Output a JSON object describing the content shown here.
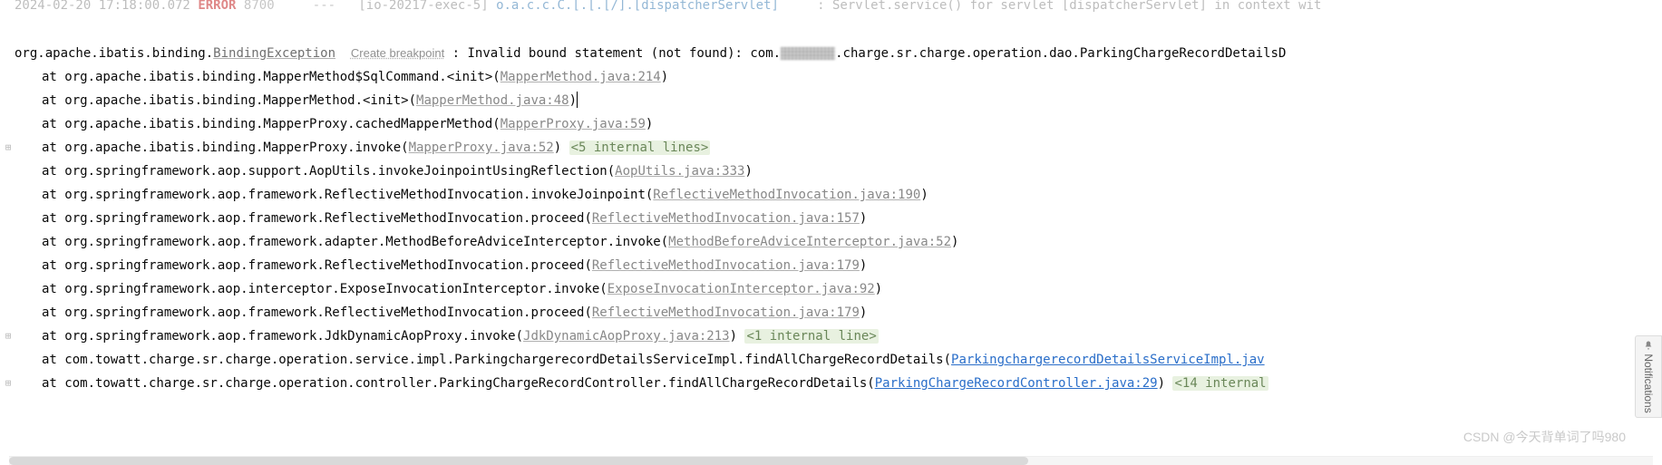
{
  "header": {
    "timestamp": "2024-02-20 17:18:00.072",
    "level": "ERROR",
    "code": "8700",
    "thread": "[io-20217-exec-5]",
    "logger": "o.a.c.c.C.[.[.[/].[dispatcherServlet]",
    "msg": ": Servlet.service() for servlet [dispatcherServlet] in context wit"
  },
  "exception": {
    "class_pkg": "org.apache.ibatis.binding.",
    "class_name": "BindingException",
    "create_bp": "Create breakpoint",
    "msg_head": " : Invalid bound statement (not found): com.",
    "msg_tail": ".charge.sr.charge.operation.dao.ParkingChargeRecordDetailsD"
  },
  "trace": [
    {
      "text": "at org.apache.ibatis.binding.MapperMethod$SqlCommand.<init>(",
      "link": "MapperMethod.java:214",
      "link_kind": "gray",
      "after": ")",
      "fold": null,
      "gutter": false
    },
    {
      "text": "at org.apache.ibatis.binding.MapperMethod.<init>(",
      "link": "MapperMethod.java:48",
      "link_kind": "gray",
      "after": ")",
      "fold": null,
      "caret": true,
      "gutter": false
    },
    {
      "text": "at org.apache.ibatis.binding.MapperProxy.cachedMapperMethod(",
      "link": "MapperProxy.java:59",
      "link_kind": "gray",
      "after": ")",
      "fold": null,
      "gutter": false
    },
    {
      "text": "at org.apache.ibatis.binding.MapperProxy.invoke(",
      "link": "MapperProxy.java:52",
      "link_kind": "gray",
      "after": ") ",
      "fold": "<5 internal lines>",
      "gutter": true
    },
    {
      "text": "at org.springframework.aop.support.AopUtils.invokeJoinpointUsingReflection(",
      "link": "AopUtils.java:333",
      "link_kind": "gray",
      "after": ")",
      "fold": null,
      "gutter": false
    },
    {
      "text": "at org.springframework.aop.framework.ReflectiveMethodInvocation.invokeJoinpoint(",
      "link": "ReflectiveMethodInvocation.java:190",
      "link_kind": "gray",
      "after": ")",
      "fold": null,
      "gutter": false
    },
    {
      "text": "at org.springframework.aop.framework.ReflectiveMethodInvocation.proceed(",
      "link": "ReflectiveMethodInvocation.java:157",
      "link_kind": "gray",
      "after": ")",
      "fold": null,
      "gutter": false
    },
    {
      "text": "at org.springframework.aop.framework.adapter.MethodBeforeAdviceInterceptor.invoke(",
      "link": "MethodBeforeAdviceInterceptor.java:52",
      "link_kind": "gray",
      "after": ")",
      "fold": null,
      "gutter": false
    },
    {
      "text": "at org.springframework.aop.framework.ReflectiveMethodInvocation.proceed(",
      "link": "ReflectiveMethodInvocation.java:179",
      "link_kind": "gray",
      "after": ")",
      "fold": null,
      "gutter": false
    },
    {
      "text": "at org.springframework.aop.interceptor.ExposeInvocationInterceptor.invoke(",
      "link": "ExposeInvocationInterceptor.java:92",
      "link_kind": "gray",
      "after": ")",
      "fold": null,
      "gutter": false
    },
    {
      "text": "at org.springframework.aop.framework.ReflectiveMethodInvocation.proceed(",
      "link": "ReflectiveMethodInvocation.java:179",
      "link_kind": "gray",
      "after": ")",
      "fold": null,
      "gutter": false
    },
    {
      "text": "at org.springframework.aop.framework.JdkDynamicAopProxy.invoke(",
      "link": "JdkDynamicAopProxy.java:213",
      "link_kind": "gray",
      "after": ") ",
      "fold": "<1 internal line>",
      "gutter": true
    },
    {
      "text": "at com.towatt.charge.sr.charge.operation.service.impl.ParkingchargerecordDetailsServiceImpl.findAllChargeRecordDetails(",
      "link": "ParkingchargerecordDetailsServiceImpl.jav",
      "link_kind": "blue",
      "after": "",
      "fold": null,
      "gutter": false
    },
    {
      "text": "at com.towatt.charge.sr.charge.operation.controller.ParkingChargeRecordController.findAllChargeRecordDetails(",
      "link": "ParkingChargeRecordController.java:29",
      "link_kind": "blue",
      "after": ") ",
      "fold": "<14 internal",
      "gutter": true
    }
  ],
  "notifications_label": "Notifications",
  "watermark": "CSDN @今天背单词了吗980"
}
